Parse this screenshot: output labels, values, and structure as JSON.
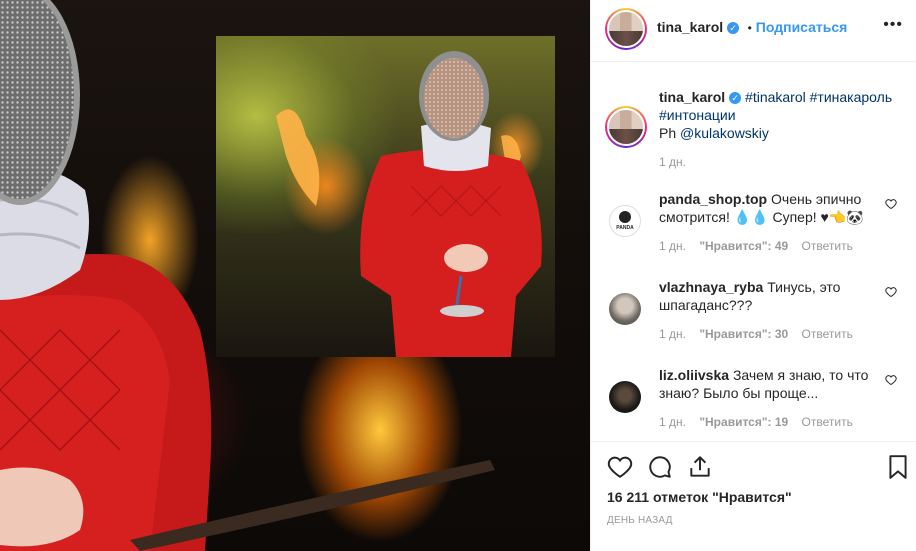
{
  "post": {
    "author": "tina_karol",
    "follow_label": "Подписаться",
    "separator": "•",
    "verified_icon": "check-badge-icon"
  },
  "caption": {
    "author": "tina_karol",
    "hashtags": [
      "#tinakarol",
      "#тинакароль",
      "#интонации"
    ],
    "credit_prefix": "Ph",
    "credit_user": "@kulakowskiy",
    "time": "1 дн."
  },
  "comments": [
    {
      "username": "panda_shop.top",
      "text": "Очень эпично смотрится! 💧💧 Супер! ♥👈🐼",
      "time": "1 дн.",
      "likes": "\"Нравится\": 49",
      "reply": "Ответить",
      "avatar_label": "PANDA"
    },
    {
      "username": "vlazhnaya_ryba",
      "text": "Тинусь, это шпагаданс???",
      "time": "1 дн.",
      "likes": "\"Нравится\": 30",
      "reply": "Ответить"
    },
    {
      "username": "liz.oliivska",
      "text": "Зачем я знаю, то что знаю? Было бы проще...",
      "time": "1 дн.",
      "likes": "\"Нравится\": 19",
      "reply": "Ответить"
    }
  ],
  "footer": {
    "likes_text": "16 211 отметок \"Нравится\"",
    "date": "ДЕНЬ НАЗАД",
    "icons": [
      "heart-icon",
      "comment-icon",
      "share-icon",
      "bookmark-icon"
    ]
  },
  "colors": {
    "link": "#3897f0",
    "text": "#262626",
    "muted": "#999999",
    "hashtag": "#003569"
  }
}
